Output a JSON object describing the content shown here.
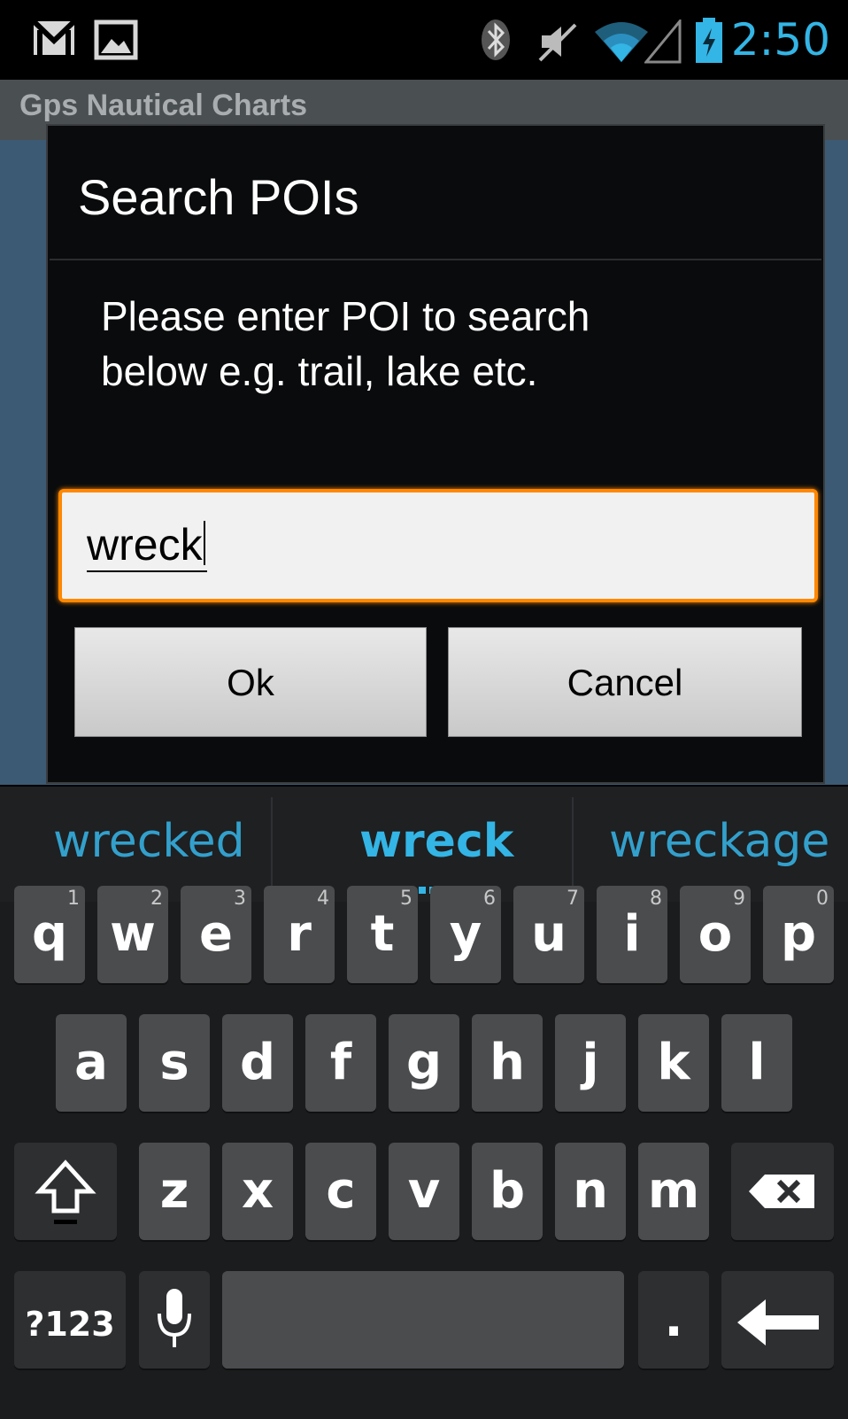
{
  "status_bar": {
    "icons": [
      "gmail-icon",
      "gallery-icon",
      "bluetooth-icon",
      "muted-icon",
      "wifi-icon",
      "signal-icon",
      "battery-charging-icon"
    ],
    "time": "2:50",
    "accent": "#33b5e5"
  },
  "app": {
    "title": "Gps Nautical Charts"
  },
  "dialog": {
    "title": "Search POIs",
    "message_line1": "Please enter POI to search",
    "message_line2": "below e.g. trail, lake etc.",
    "input_value": "wreck",
    "ok_label": "Ok",
    "cancel_label": "Cancel",
    "focus_color": "#ff8800"
  },
  "suggestions": [
    "wrecked",
    "wreck",
    "wreckage"
  ],
  "keyboard": {
    "row1": [
      {
        "k": "q",
        "h": "1"
      },
      {
        "k": "w",
        "h": "2"
      },
      {
        "k": "e",
        "h": "3"
      },
      {
        "k": "r",
        "h": "4"
      },
      {
        "k": "t",
        "h": "5"
      },
      {
        "k": "y",
        "h": "6"
      },
      {
        "k": "u",
        "h": "7"
      },
      {
        "k": "i",
        "h": "8"
      },
      {
        "k": "o",
        "h": "9"
      },
      {
        "k": "p",
        "h": "0"
      }
    ],
    "row2": [
      "a",
      "s",
      "d",
      "f",
      "g",
      "h",
      "j",
      "k",
      "l"
    ],
    "row3": [
      "z",
      "x",
      "c",
      "v",
      "b",
      "n",
      "m"
    ],
    "symbols_label": "?123",
    "period_label": ".",
    "shift_icon": "shift-icon",
    "delete_icon": "backspace-icon",
    "mic_icon": "microphone-icon",
    "enter_icon": "enter-icon"
  }
}
